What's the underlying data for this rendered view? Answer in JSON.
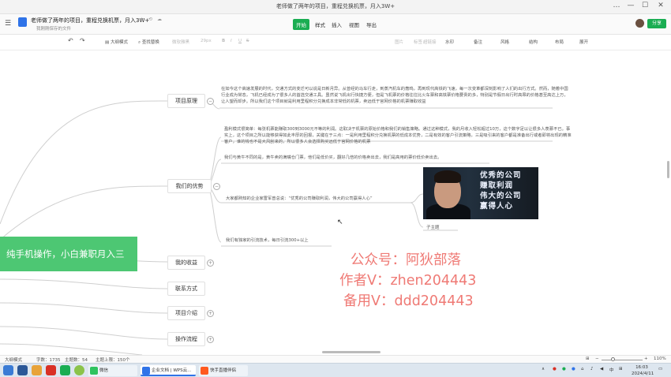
{
  "window": {
    "title": "老师做了两年的项目，重程兑换机票，月入3W+",
    "controls": [
      "…",
      "—",
      "☐",
      "✕"
    ]
  },
  "doc": {
    "title": "老师做了两年的项目，重程兑换机票，月入3W+",
    "subtitle": "我刚刚保存的文件",
    "tabs": [
      "开始",
      "样式",
      "插入",
      "视图",
      "导出"
    ],
    "active_tab": "开始",
    "share_label": "分享"
  },
  "toolbar": {
    "undo": "↶",
    "redo": "↷",
    "outline_mode": "大纲模式",
    "find_replace": "查找替换",
    "font_name": "微软雅黑",
    "font_size": "29px",
    "bold": "B",
    "italic": "I",
    "underline": "U",
    "strike": "S",
    "image": "图片",
    "label": "标签",
    "link": "超链接",
    "watermark": "水印",
    "note": "备注",
    "style": "风格",
    "structure": "结构",
    "layout": "布局",
    "more": "展开"
  },
  "mindmap": {
    "root": "纯手机操作，小白兼职月入三",
    "branches": [
      {
        "label": "项目原理"
      },
      {
        "label": "我们的优势"
      },
      {
        "label": "我的收益"
      },
      {
        "label": "联系方式"
      },
      {
        "label": "项目介绍"
      },
      {
        "label": "操作流程"
      }
    ],
    "principle_text": "在如今这个高速发展的时代，交通方式的变迁可以说是日新月异。从曾经的马车行走，到蒸汽机车的轰鸣，再到现代高铁的飞速，每一次变革都深刻影响了人们的出行方式。然而，随着中国行业成为常态，飞机已经成为了很多人的首选交通工具。虽然说飞机出行快捷方便，但是飞机票的价格往往比火车票和高铁票价格要贵的多，特别是节假日出行时高昂的价格甚至高达上万，让人望而却步。所以我们这个项目就是利用里程积分兑换成本非常低的机票，卖远低于官网价格的机票赚取收益",
    "advantage_1": "盈利模式很简单：每张机票能赚取300到3000元不等的利润。这取决于机票的原始价格和我们的销售策略。通过这种模式，我的月收入轻松超过10万，这个数字足以让很多人羡慕不已。事实上，这个项目之所以能够获得如此丰厚的回报，关键在于三点：一是利用里程积分兑换机票的低成本优势，二是有效的客户引流策略，三是吸引来的客户都是准备出行或者即将出现的精准客户，谁的钱也不是大风刮来的，所以很多人会选择购买远低于官网价格的机票",
    "advantage_2": "我们与黄牛不同的是，黄牛卖的满嘴仓门票，他们是低价买，翻好几倍的价格卖出去，我们是高用的票价低价卖出去。",
    "advantage_3": "大家都熟知的企业家雷军曾总说：“优秀的公司赚取利润，伟大的公司赢得人心”",
    "advantage_4": "我们有独家的引流技术，每日引流300+以上",
    "photo_slogan": [
      "优秀的公司",
      "赚取利润",
      "伟大的公司",
      "赢得人心"
    ],
    "photo_caption": "子主题"
  },
  "watermark": {
    "line1": "公众号：阿狄部落",
    "line2": "作者V：zhen204443",
    "line3": "备用V：ddd204443"
  },
  "status": {
    "outline_mode": "大纲模式",
    "word_count": "字数：1735",
    "topic_count": "主题数：54",
    "topic_limit": "主题上限：150个",
    "zoom": "110%"
  },
  "taskbar": {
    "apps": [
      {
        "label": "微信",
        "color": "#2fc35f"
      },
      {
        "label": "企业文档 | WPS云...",
        "color": "#2f73e8"
      },
      {
        "label": "快手直播伴侣",
        "color": "#ff5a1f"
      }
    ],
    "time": "16:03",
    "date": "2024/4/11"
  },
  "colors": {
    "brand_green": "#1aad52",
    "root_green": "#4dc773",
    "watermark": "#ef7a75"
  }
}
